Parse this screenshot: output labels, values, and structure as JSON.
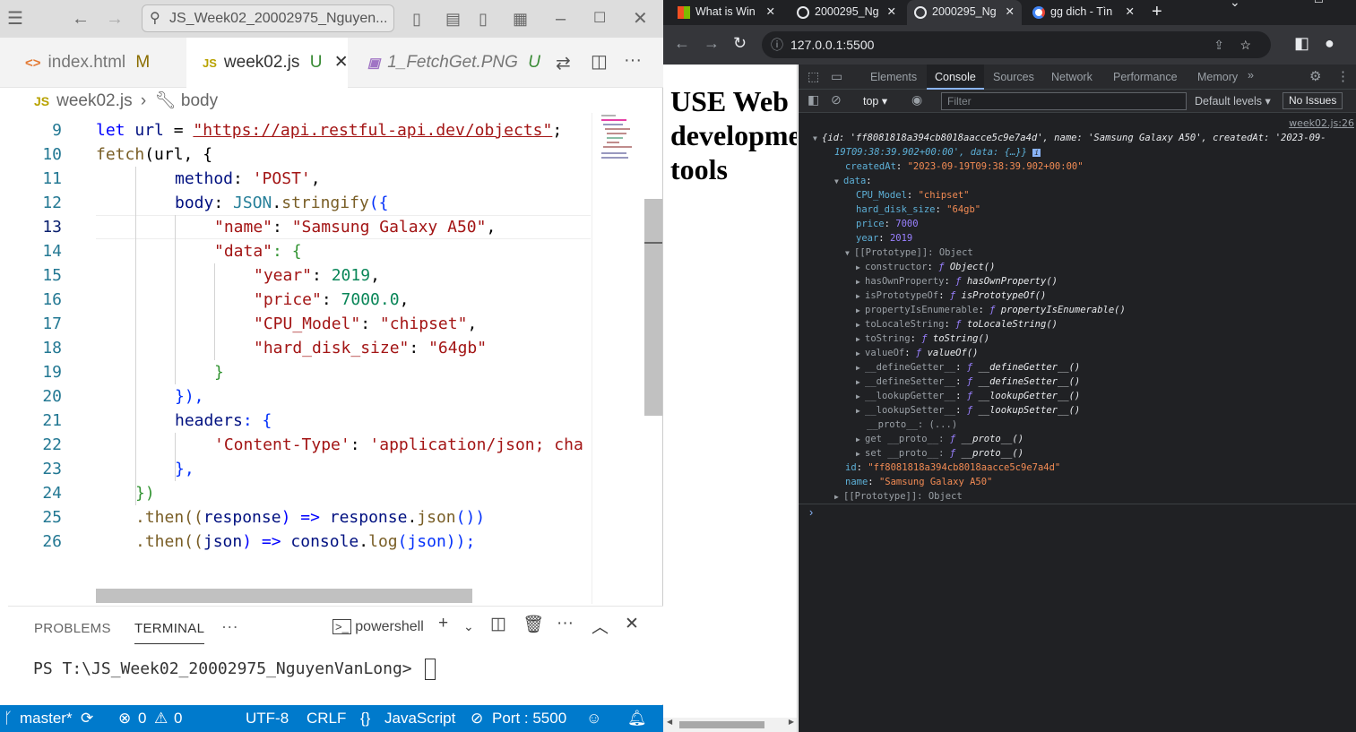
{
  "vscode": {
    "search_text": "JS_Week02_20002975_Nguyen...",
    "tabs": [
      {
        "name": "index.html",
        "badge": "M"
      },
      {
        "name": "week02.js",
        "badge": "U"
      },
      {
        "name": "1_FetchGet.PNG",
        "badge": "U"
      }
    ],
    "breadcrumb": {
      "file": "week02.js",
      "symbol": "body",
      "js_badge": "JS"
    },
    "line_numbers": [
      "9",
      "10",
      "11",
      "12",
      "13",
      "14",
      "15",
      "16",
      "17",
      "18",
      "19",
      "20",
      "21",
      "22",
      "23",
      "24",
      "25",
      "26"
    ],
    "code": {
      "l9_kw": "let",
      "l9_var": "url",
      "l9_eq": " = ",
      "l9_str": "\"https://api.restful-api.dev/objects\"",
      "l9_end": ";",
      "l10_fn": "fetch",
      "l10_rest": "(url, {",
      "l11_key": "method",
      "l11_colon": ": ",
      "l11_val": "'POST'",
      "l11_end": ",",
      "l12_key": "body",
      "l12_colon": ": ",
      "l12_obj": "JSON",
      "l12_dot": ".",
      "l12_fn": "stringify",
      "l12_open": "({",
      "l13_key": "\"name\"",
      "l13_colon": ": ",
      "l13_val": "\"Samsung Galaxy A50\"",
      "l13_end": ",",
      "l14_key": "\"data\"",
      "l14_rest": ": {",
      "l15_key": "\"year\"",
      "l15_colon": ": ",
      "l15_val": "2019",
      "l15_end": ",",
      "l16_key": "\"price\"",
      "l16_colon": ": ",
      "l16_val": "7000.0",
      "l16_end": ",",
      "l17_key": "\"CPU_Model\"",
      "l17_colon": ": ",
      "l17_val": "\"chipset\"",
      "l17_end": ",",
      "l18_key": "\"hard_disk_size\"",
      "l18_colon": ": ",
      "l18_val": "\"64gb\"",
      "l19": "}",
      "l20": "}),",
      "l21_key": "headers",
      "l21_rest": ": {",
      "l22_key": "'Content-Type'",
      "l22_colon": ": ",
      "l22_val": "'application/json; cha",
      "l23": "},",
      "l24": "})",
      "l25_a": ".then((",
      "l25_p": "response",
      "l25_b": ") => ",
      "l25_c": "response",
      "l25_d": ".",
      "l25_fn": "json",
      "l25_e": "())",
      "l26_a": ".then((",
      "l26_p": "json",
      "l26_b": ") => ",
      "l26_c": "console",
      "l26_d": ".",
      "l26_fn": "log",
      "l26_e": "(json));"
    },
    "panel": {
      "tabs": [
        "PROBLEMS",
        "TERMINAL"
      ],
      "more": "···",
      "shell": "powershell",
      "terminal_text": "PS T:\\JS_Week02_20002975_NguyenVanLong> "
    },
    "status": {
      "branch": "master*",
      "errors": "0",
      "warnings": "0",
      "encoding": "UTF-8",
      "eol": "CRLF",
      "language": "JavaScript",
      "port": "Port : 5500"
    }
  },
  "browser": {
    "tabs": [
      {
        "title": "What is Win",
        "color": "#f25022"
      },
      {
        "title": "2000295_Ng",
        "color": "#e8eaed"
      },
      {
        "title": "2000295_Ng",
        "color": "#e8eaed"
      },
      {
        "title": "gg dich - Tìn",
        "color": "#4285f4"
      }
    ],
    "url": "127.0.0.1:5500",
    "page_heading": "USE Web developme tools",
    "devtools": {
      "tabs": [
        "Elements",
        "Console",
        "Sources",
        "Network",
        "Performance",
        "Memory"
      ],
      "context": "top",
      "filter_placeholder": "Filter",
      "levels": "Default levels",
      "issues": "No Issues",
      "source_link": "week02.js:26",
      "log": {
        "summary_1": "{id: 'ff8081818a394cb8018aacce5c9e7a4d', name: 'Samsung Galaxy A50', createdAt: '2023-09-",
        "summary_2": "19T09:38:39.902+00:00', data: {…}}",
        "createdAt": "\"2023-09-19T09:38:39.902+00:00\"",
        "cpu": "\"chipset\"",
        "hdd": "\"64gb\"",
        "price": "7000",
        "year": "2019",
        "proto_obj": "[[Prototype]]: Object",
        "proto_items": [
          {
            "k": "constructor",
            "v": "Object()"
          },
          {
            "k": "hasOwnProperty",
            "v": "hasOwnProperty()"
          },
          {
            "k": "isPrototypeOf",
            "v": "isPrototypeOf()"
          },
          {
            "k": "propertyIsEnumerable",
            "v": "propertyIsEnumerable()"
          },
          {
            "k": "toLocaleString",
            "v": "toLocaleString()"
          },
          {
            "k": "toString",
            "v": "toString()"
          },
          {
            "k": "valueOf",
            "v": "valueOf()"
          },
          {
            "k": "__defineGetter__",
            "v": "__defineGetter__()"
          },
          {
            "k": "__defineSetter__",
            "v": "__defineSetter__()"
          },
          {
            "k": "__lookupGetter__",
            "v": "__lookupGetter__()"
          },
          {
            "k": "__lookupSetter__",
            "v": "__lookupSetter__()"
          }
        ],
        "proto_dunder": "__proto__: (...)",
        "get_proto": "get __proto__: ",
        "set_proto": "set __proto__: ",
        "proto_fn": "__proto__()",
        "id": "\"ff8081818a394cb8018aacce5c9e7a4d\"",
        "name": "\"Samsung Galaxy A50\"",
        "outer_proto": "[[Prototype]]: Object"
      }
    }
  }
}
